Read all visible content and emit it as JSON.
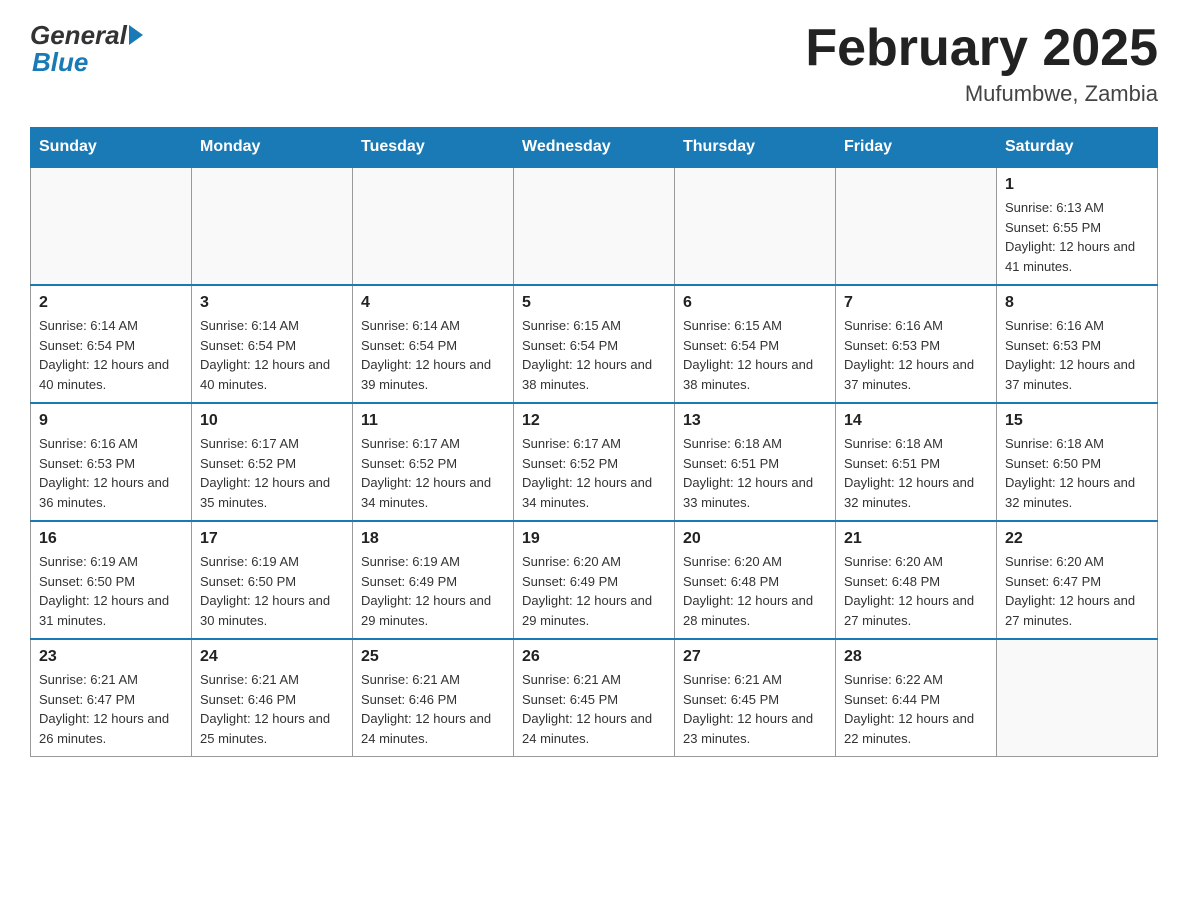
{
  "logo": {
    "general": "General",
    "blue": "Blue"
  },
  "title": "February 2025",
  "location": "Mufumbwe, Zambia",
  "days_of_week": [
    "Sunday",
    "Monday",
    "Tuesday",
    "Wednesday",
    "Thursday",
    "Friday",
    "Saturday"
  ],
  "weeks": [
    [
      {
        "day": "",
        "info": ""
      },
      {
        "day": "",
        "info": ""
      },
      {
        "day": "",
        "info": ""
      },
      {
        "day": "",
        "info": ""
      },
      {
        "day": "",
        "info": ""
      },
      {
        "day": "",
        "info": ""
      },
      {
        "day": "1",
        "info": "Sunrise: 6:13 AM\nSunset: 6:55 PM\nDaylight: 12 hours and 41 minutes."
      }
    ],
    [
      {
        "day": "2",
        "info": "Sunrise: 6:14 AM\nSunset: 6:54 PM\nDaylight: 12 hours and 40 minutes."
      },
      {
        "day": "3",
        "info": "Sunrise: 6:14 AM\nSunset: 6:54 PM\nDaylight: 12 hours and 40 minutes."
      },
      {
        "day": "4",
        "info": "Sunrise: 6:14 AM\nSunset: 6:54 PM\nDaylight: 12 hours and 39 minutes."
      },
      {
        "day": "5",
        "info": "Sunrise: 6:15 AM\nSunset: 6:54 PM\nDaylight: 12 hours and 38 minutes."
      },
      {
        "day": "6",
        "info": "Sunrise: 6:15 AM\nSunset: 6:54 PM\nDaylight: 12 hours and 38 minutes."
      },
      {
        "day": "7",
        "info": "Sunrise: 6:16 AM\nSunset: 6:53 PM\nDaylight: 12 hours and 37 minutes."
      },
      {
        "day": "8",
        "info": "Sunrise: 6:16 AM\nSunset: 6:53 PM\nDaylight: 12 hours and 37 minutes."
      }
    ],
    [
      {
        "day": "9",
        "info": "Sunrise: 6:16 AM\nSunset: 6:53 PM\nDaylight: 12 hours and 36 minutes."
      },
      {
        "day": "10",
        "info": "Sunrise: 6:17 AM\nSunset: 6:52 PM\nDaylight: 12 hours and 35 minutes."
      },
      {
        "day": "11",
        "info": "Sunrise: 6:17 AM\nSunset: 6:52 PM\nDaylight: 12 hours and 34 minutes."
      },
      {
        "day": "12",
        "info": "Sunrise: 6:17 AM\nSunset: 6:52 PM\nDaylight: 12 hours and 34 minutes."
      },
      {
        "day": "13",
        "info": "Sunrise: 6:18 AM\nSunset: 6:51 PM\nDaylight: 12 hours and 33 minutes."
      },
      {
        "day": "14",
        "info": "Sunrise: 6:18 AM\nSunset: 6:51 PM\nDaylight: 12 hours and 32 minutes."
      },
      {
        "day": "15",
        "info": "Sunrise: 6:18 AM\nSunset: 6:50 PM\nDaylight: 12 hours and 32 minutes."
      }
    ],
    [
      {
        "day": "16",
        "info": "Sunrise: 6:19 AM\nSunset: 6:50 PM\nDaylight: 12 hours and 31 minutes."
      },
      {
        "day": "17",
        "info": "Sunrise: 6:19 AM\nSunset: 6:50 PM\nDaylight: 12 hours and 30 minutes."
      },
      {
        "day": "18",
        "info": "Sunrise: 6:19 AM\nSunset: 6:49 PM\nDaylight: 12 hours and 29 minutes."
      },
      {
        "day": "19",
        "info": "Sunrise: 6:20 AM\nSunset: 6:49 PM\nDaylight: 12 hours and 29 minutes."
      },
      {
        "day": "20",
        "info": "Sunrise: 6:20 AM\nSunset: 6:48 PM\nDaylight: 12 hours and 28 minutes."
      },
      {
        "day": "21",
        "info": "Sunrise: 6:20 AM\nSunset: 6:48 PM\nDaylight: 12 hours and 27 minutes."
      },
      {
        "day": "22",
        "info": "Sunrise: 6:20 AM\nSunset: 6:47 PM\nDaylight: 12 hours and 27 minutes."
      }
    ],
    [
      {
        "day": "23",
        "info": "Sunrise: 6:21 AM\nSunset: 6:47 PM\nDaylight: 12 hours and 26 minutes."
      },
      {
        "day": "24",
        "info": "Sunrise: 6:21 AM\nSunset: 6:46 PM\nDaylight: 12 hours and 25 minutes."
      },
      {
        "day": "25",
        "info": "Sunrise: 6:21 AM\nSunset: 6:46 PM\nDaylight: 12 hours and 24 minutes."
      },
      {
        "day": "26",
        "info": "Sunrise: 6:21 AM\nSunset: 6:45 PM\nDaylight: 12 hours and 24 minutes."
      },
      {
        "day": "27",
        "info": "Sunrise: 6:21 AM\nSunset: 6:45 PM\nDaylight: 12 hours and 23 minutes."
      },
      {
        "day": "28",
        "info": "Sunrise: 6:22 AM\nSunset: 6:44 PM\nDaylight: 12 hours and 22 minutes."
      },
      {
        "day": "",
        "info": ""
      }
    ]
  ]
}
